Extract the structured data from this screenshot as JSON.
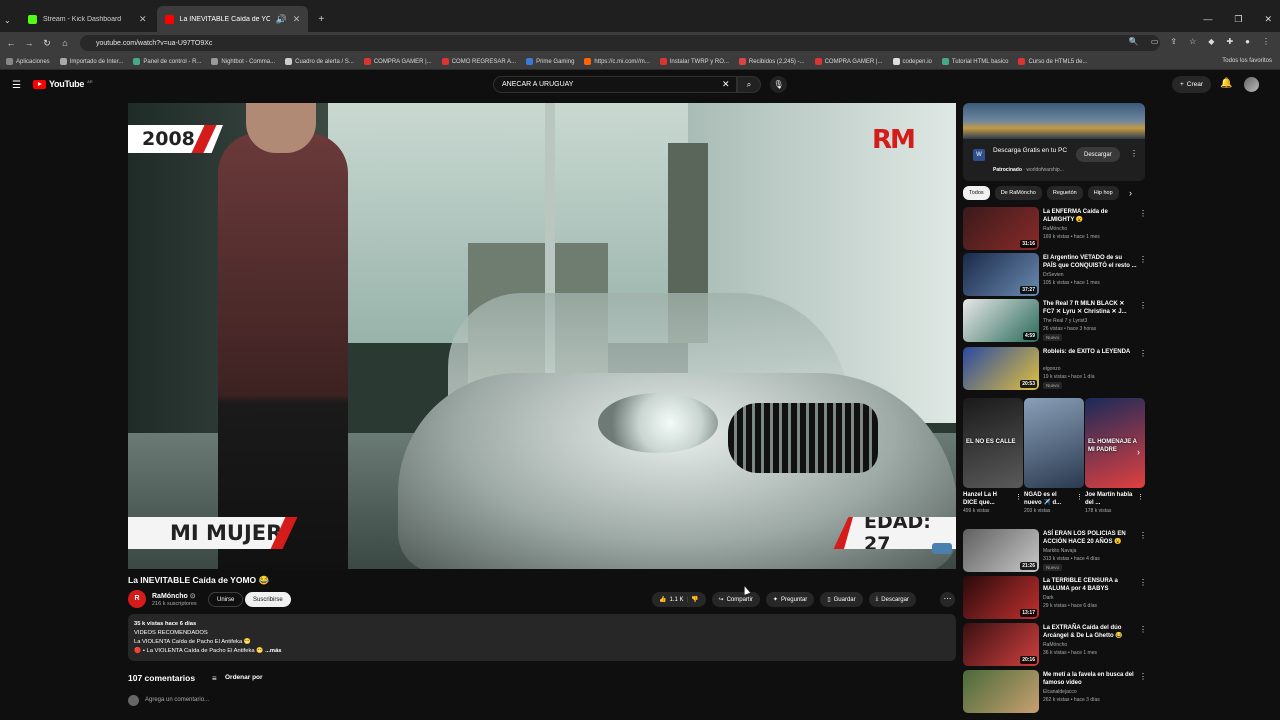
{
  "browser": {
    "tabs": [
      {
        "title": "Stream - Kick Dashboard",
        "color": "#53fc18",
        "active": false
      },
      {
        "title": "La INEVITABLE Caída de YO",
        "color": "#ff0000",
        "active": true
      }
    ],
    "url": "youtube.com/watch?v=ua-U97TO9Xc",
    "bookmarks": [
      "Aplicaciones",
      "Importado de Inter...",
      "Panel de control - R...",
      "Nightbot - Comma...",
      "Cuadro de alerta / S...",
      "COMPRA GAMER |...",
      "COMO REGRESAR A...",
      "Prime Gaming",
      "https://c.mi.com//m...",
      "Instalar TWRP y RO...",
      "Recibidos (2,245) -...",
      "COMPRA GAMER |...",
      "codepen.io",
      "Tutorial HTML basico",
      "Curso de HTML5 de..."
    ],
    "bookmarks_right": "Todos los favoritos"
  },
  "header": {
    "logo": "YouTube",
    "country": "AR",
    "search_value": "ANECAR A URUGUAY",
    "create": "Crear"
  },
  "player": {
    "year_overlay": "2008",
    "logo_overlay": "RM",
    "left_caption": "MI MUJER",
    "right_caption": "EDAD: 27"
  },
  "video": {
    "title": "La INEVITABLE Caída de YOMO 😂",
    "channel": "RaMóncho",
    "subscribers": "216 k suscriptores",
    "join": "Unirse",
    "subscribe": "Suscribirse",
    "likes": "1.1 K",
    "share": "Compartir",
    "ask": "Preguntar",
    "save": "Guardar",
    "download": "Descargar",
    "description": {
      "views": "35 k vistas  hace 6 días",
      "line1": "VIDEOS RECOMENDADOS",
      "line2": "La VIOLENTA Caída de Pacho El Antifeka 😁",
      "line3": "🔴 • La VIOLENTA Caída de Pacho El Antifeka 😁",
      "more": "...más"
    },
    "comments_count": "107 comentarios",
    "sort": "Ordenar por",
    "comment_placeholder": "Agrega un comentario..."
  },
  "sidebar": {
    "ad": {
      "title": "Descarga Gratis en tu PC",
      "sponsored": "Patrocinado",
      "advertiser": "worldofwarship...",
      "button": "Descargar"
    },
    "chips": [
      "Todos",
      "De RaMóncho",
      "Reguetón",
      "Hip hop"
    ],
    "recs": [
      {
        "title": "La ENFERMA Caída de ALMIGHTY 😮",
        "channel": "RaMóncho",
        "meta": "169 k vistas • hace 1 mes",
        "duration": "31:16",
        "badge": "",
        "colors": [
          "#3a1a1a",
          "#8a2a2a"
        ]
      },
      {
        "title": "El Argentino VETADO de su PAÍS que CONQUISTÓ el resto ...",
        "channel": "DrSevien",
        "meta": "105 k vistas • hace 1 mes",
        "duration": "37:27",
        "badge": "",
        "colors": [
          "#1a2a4a",
          "#6a8ab0"
        ]
      },
      {
        "title": "The Real 7 ft MILN BLACK ✕ FC7 ✕ Lyru ✕ Christina ✕ J...",
        "channel": "The Real 7 y Lyrist3",
        "meta": "26 vistas • hace 3 horas",
        "duration": "4:59",
        "badge": "Nuevo",
        "colors": [
          "#e8e8e8",
          "#2a6a5a"
        ]
      },
      {
        "title": "Robleis: de EXITO a LEYENDA",
        "channel": "elgonzo",
        "meta": "19 k vistas • hace 1 día",
        "duration": "20:53",
        "badge": "Nuevo",
        "colors": [
          "#2a4aa0",
          "#e0c040"
        ]
      },
      {
        "title": "ASÍ ERAN LOS POLICIAS EN ACCIÓN HACE 20 AÑOS 😮",
        "channel": "Markito Navaja",
        "meta": "313 k vistas • hace 4 días",
        "duration": "21:26",
        "badge": "Nuevo",
        "colors": [
          "#606060",
          "#c8c8c8"
        ]
      },
      {
        "title": "La TERRIBLE CENSURA a MALUMA por 4 BABYS",
        "channel": "Dark",
        "meta": "29 k vistas • hace 6 días",
        "duration": "13:17",
        "badge": "",
        "colors": [
          "#2a0a0a",
          "#c03030"
        ]
      },
      {
        "title": "La EXTRAÑA Caída del dúo Arcángel & De La Ghetto 😂",
        "channel": "RaMóncho",
        "meta": "36 k vistas • hace 1 mes",
        "duration": "20:16",
        "badge": "",
        "colors": [
          "#3a1010",
          "#d04040"
        ]
      },
      {
        "title": "Me metí a la favela en busca del famoso video",
        "channel": "Elcanaldejacco",
        "meta": "262 k vistas • hace 3 días",
        "duration": "",
        "badge": "",
        "colors": [
          "#4a6a3a",
          "#c8a070"
        ]
      }
    ],
    "shorts": [
      {
        "title": "Hanzel La H DICE que...",
        "views": "499 k vistas",
        "caption": "EL NO ES CALLE",
        "colors": [
          "#1a1a1a",
          "#5a5a5a"
        ]
      },
      {
        "title": "NGAD es el nuevo ✈️ d...",
        "views": "203 k vistas",
        "caption": "",
        "colors": [
          "#8aa0b8",
          "#2a3a50"
        ]
      },
      {
        "title": "Joe Martín habla del ...",
        "views": "178 k vistas",
        "caption": "EL HOMENAJE A MI PADRE",
        "colors": [
          "#1a2a5a",
          "#e04040"
        ]
      }
    ]
  }
}
